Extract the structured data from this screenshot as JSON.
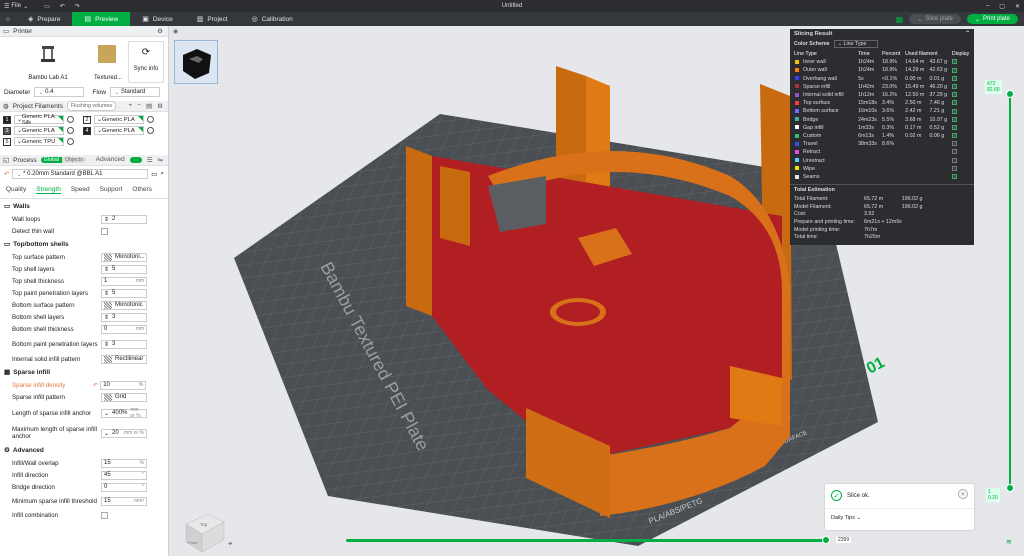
{
  "titlebar": {
    "file_label": "File",
    "title": "Untitled"
  },
  "tabs": [
    {
      "label": "Prepare",
      "icon": "cube-icon"
    },
    {
      "label": "Preview",
      "icon": "preview-icon"
    },
    {
      "label": "Device",
      "icon": "device-icon"
    },
    {
      "label": "Project",
      "icon": "project-icon"
    },
    {
      "label": "Calibration",
      "icon": "calibration-icon"
    }
  ],
  "actions": {
    "slice_plate": "Slice plate",
    "print_plate": "Print plate"
  },
  "printer": {
    "section": "Printer",
    "name": "Bambu Lab A1",
    "plate": "Textured...",
    "sync": "Sync info",
    "diameter_label": "Diameter",
    "diameter_value": "0.4",
    "flow_label": "Flow",
    "flow_value": "Standard"
  },
  "filaments": {
    "section": "Project Filaments",
    "flushing": "Flushing volumes",
    "items": [
      {
        "num": "1",
        "name": "Generic PLA Silk",
        "color": "#111111"
      },
      {
        "num": "2",
        "name": "Generic PLA",
        "color": "#ffffff"
      },
      {
        "num": "3",
        "name": "Generic PLA",
        "color": "#555555"
      },
      {
        "num": "4",
        "name": "Generic PLA",
        "color": "#222222"
      },
      {
        "num": "5",
        "name": "Generic TPU",
        "color": "#ffffff"
      }
    ]
  },
  "process": {
    "section": "Process",
    "global": "Global",
    "objects": "Objects",
    "advanced": "Advanced",
    "profile": "* 0.20mm Standard @BBL A1",
    "tabs": [
      "Quality",
      "Strength",
      "Speed",
      "Support",
      "Others"
    ],
    "walls_group": "Walls",
    "wall_loops": "Wall loops",
    "wall_loops_val": "2",
    "detect_thin": "Detect thin wall",
    "topbottom_group": "Top/bottom shells",
    "top_pattern": "Top surface pattern",
    "top_pattern_val": "Monotoni...",
    "top_layers": "Top shell layers",
    "top_layers_val": "5",
    "top_thick": "Top shell thickness",
    "top_thick_val": "1",
    "top_paint": "Top paint penetration layers",
    "top_paint_val": "5",
    "bottom_pattern": "Bottom surface pattern",
    "bottom_pattern_val": "Monotonic",
    "bottom_layers": "Bottom shell layers",
    "bottom_layers_val": "3",
    "bottom_thick": "Bottom shell thickness",
    "bottom_thick_val": "0",
    "bottom_paint": "Bottom paint penetration layers",
    "bottom_paint_val": "3",
    "internal_solid": "Internal solid infill pattern",
    "internal_solid_val": "Rectilinear",
    "sparse_group": "Sparse infill",
    "sparse_density": "Sparse infill density",
    "sparse_density_val": "10",
    "sparse_pattern": "Sparse infill pattern",
    "sparse_pattern_val": "Grid",
    "anchor_len": "Length of sparse infill anchor",
    "anchor_len_val": "400%",
    "anchor_max": "Maximum length of sparse infill anchor",
    "anchor_max_val": "20",
    "advanced_group": "Advanced",
    "wall_overlap": "Infill/Wall overlap",
    "wall_overlap_val": "15",
    "infill_dir": "Infill direction",
    "infill_dir_val": "45",
    "bridge_dir": "Bridge direction",
    "bridge_dir_val": "0",
    "min_sparse": "Minimum sparse infill threshold",
    "min_sparse_val": "15",
    "infill_comb": "Infill combination",
    "unit_mm": "mm",
    "unit_pct": "%",
    "unit_mm_pct": "mm or %",
    "unit_mm2": "mm²"
  },
  "slicing": {
    "title": "Slicing Result",
    "scheme_label": "Color Scheme",
    "scheme_value": "Line Type",
    "headers": [
      "Line Type",
      "Time",
      "Percent",
      "Used filament",
      "Display"
    ],
    "rows": [
      {
        "name": "Inner wall",
        "color": "#f2c500",
        "time": "1h24m",
        "pct": "18.9%",
        "len": "14.64 m",
        "g": "43.67 g",
        "on": true
      },
      {
        "name": "Outer wall",
        "color": "#ff7f00",
        "time": "1h24m",
        "pct": "18.9%",
        "len": "14.29 m",
        "g": "42.63 g",
        "on": true
      },
      {
        "name": "Overhang wall",
        "color": "#3c3cff",
        "time": "5s",
        "pct": "<0.1%",
        "len": "0.00 m",
        "g": "0.01 g",
        "on": true
      },
      {
        "name": "Sparse infill",
        "color": "#b03131",
        "time": "1h42m",
        "pct": "23.0%",
        "len": "15.49 m",
        "g": "46.20 g",
        "on": true
      },
      {
        "name": "Internal solid infill",
        "color": "#9a4ed2",
        "time": "1h12m",
        "pct": "16.2%",
        "len": "12.50 m",
        "g": "37.29 g",
        "on": true
      },
      {
        "name": "Top surface",
        "color": "#ff3a3a",
        "time": "15m18s",
        "pct": "3.4%",
        "len": "2.50 m",
        "g": "7.46 g",
        "on": true
      },
      {
        "name": "Bottom surface",
        "color": "#6a6aff",
        "time": "16m10s",
        "pct": "3.6%",
        "len": "2.42 m",
        "g": "7.21 g",
        "on": true
      },
      {
        "name": "Bridge",
        "color": "#4aa8a8",
        "time": "24m23s",
        "pct": "5.5%",
        "len": "3.68 m",
        "g": "10.97 g",
        "on": true
      },
      {
        "name": "Gap infill",
        "color": "#ffffff",
        "time": "1m33s",
        "pct": "0.3%",
        "len": "0.17 m",
        "g": "0.52 g",
        "on": true
      },
      {
        "name": "Custom",
        "color": "#2fbf6f",
        "time": "6m13s",
        "pct": "1.4%",
        "len": "0.02 m",
        "g": "0.06 g",
        "on": true
      },
      {
        "name": "Travel",
        "color": "#3a4cf0",
        "time": "38m33s",
        "pct": "8.6%",
        "len": "",
        "g": "",
        "on": false
      },
      {
        "name": "Retract",
        "color": "#e34de3",
        "time": "",
        "pct": "",
        "len": "",
        "g": "",
        "on": false
      },
      {
        "name": "Unretract",
        "color": "#5fd0f0",
        "time": "",
        "pct": "",
        "len": "",
        "g": "",
        "on": false
      },
      {
        "name": "Wipe",
        "color": "#f2e600",
        "time": "",
        "pct": "",
        "len": "",
        "g": "",
        "on": false
      },
      {
        "name": "Seams",
        "color": "#e6e6e6",
        "time": "",
        "pct": "",
        "len": "",
        "g": "",
        "on": true
      }
    ],
    "est_title": "Total Estimation",
    "est": [
      {
        "label": "Total Filament:",
        "a": "65.72 m",
        "b": "196.02 g"
      },
      {
        "label": "Model Filament:",
        "a": "65.72 m",
        "b": "196.02 g"
      },
      {
        "label": "Cost:",
        "a": "3.92",
        "b": ""
      },
      {
        "label": "Prepare and printing time:",
        "a": "6m21s + 12m9s",
        "b": ""
      },
      {
        "label": "Model printing time:",
        "a": "7h7m",
        "b": ""
      },
      {
        "label": "Total time:",
        "a": "7h26m",
        "b": ""
      }
    ]
  },
  "viewport": {
    "plate_label": "Bambu Textured PEI Plate",
    "plate_number": "01",
    "layer_top_val": "473",
    "layer_top_h": "82.60",
    "layer_bottom_val": "1",
    "layer_bottom_h": "0.20",
    "move_value": "2399",
    "cube_top": "Top",
    "cube_front": "Front",
    "slice_ok": "Slice ok.",
    "daily_tips": "Daily Tips",
    "plate_text_a": "PLA/ABS/PETG",
    "plate_text_b": "HOT SURFACE"
  }
}
